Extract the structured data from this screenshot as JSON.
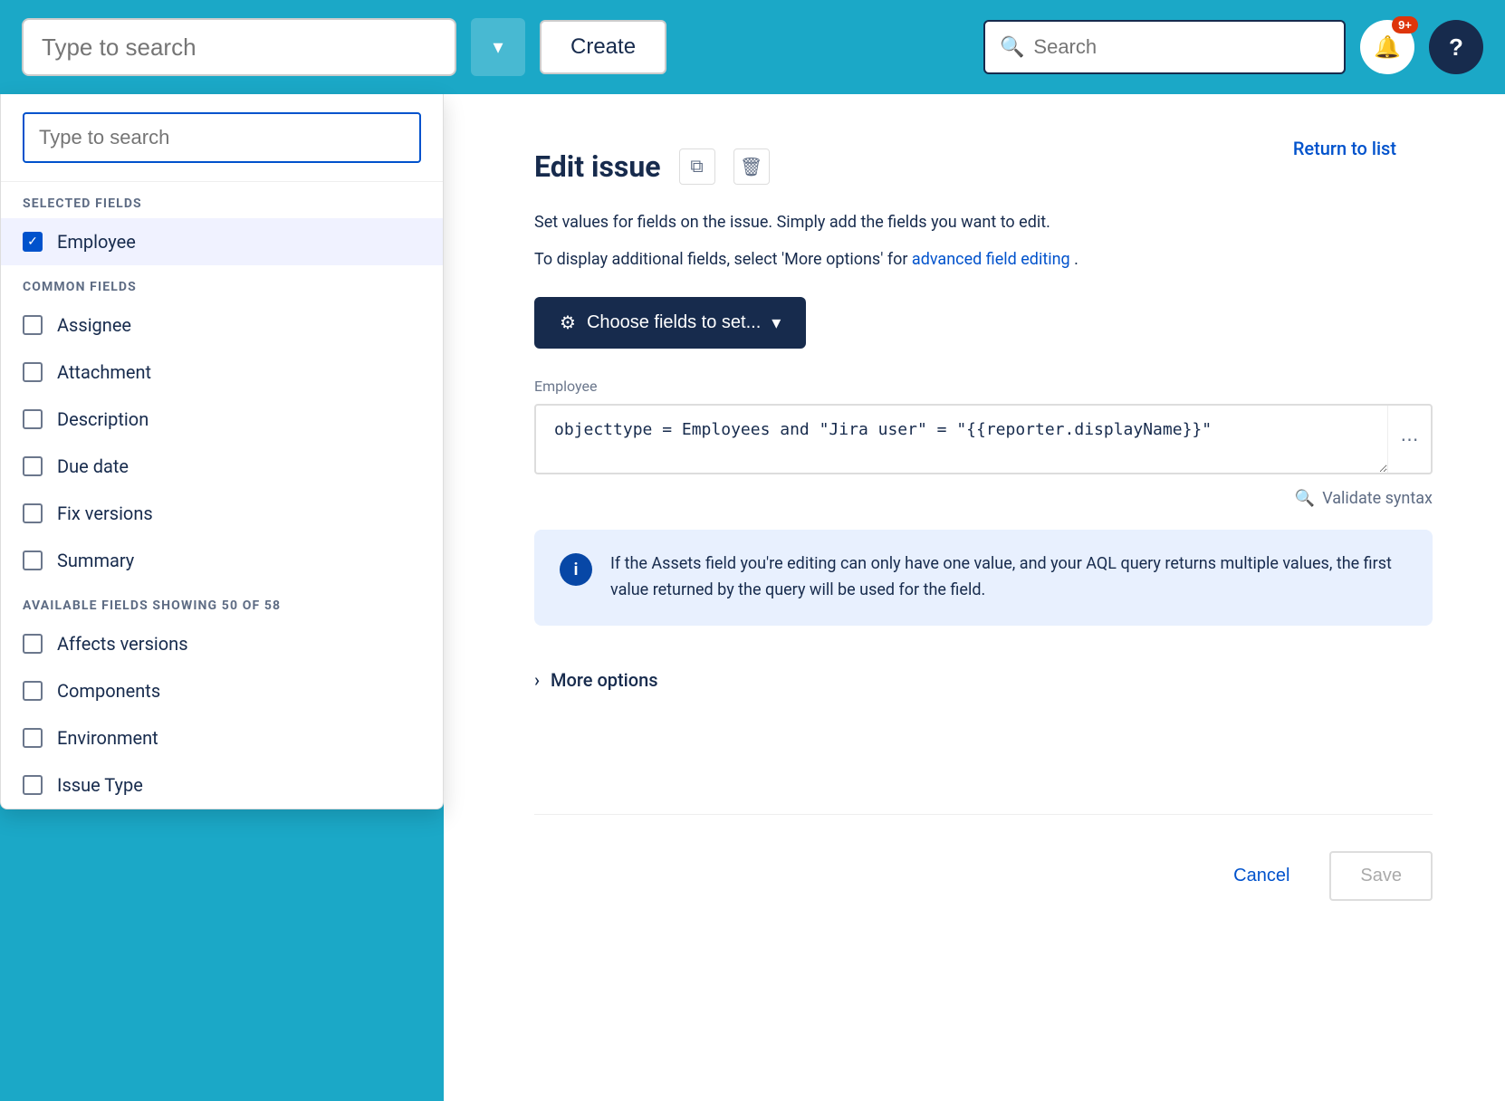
{
  "nav": {
    "search_placeholder": "Type to search",
    "create_label": "Create",
    "search_label": "Search",
    "notif_badge": "9+",
    "help_symbol": "?"
  },
  "dropdown": {
    "search_placeholder": "Type to search",
    "selected_fields_header": "SELECTED FIELDS",
    "selected_items": [
      {
        "label": "Employee",
        "checked": true
      }
    ],
    "common_fields_header": "COMMON FIELDS",
    "common_items": [
      {
        "label": "Assignee",
        "checked": false
      },
      {
        "label": "Attachment",
        "checked": false
      },
      {
        "label": "Description",
        "checked": false
      },
      {
        "label": "Due date",
        "checked": false
      },
      {
        "label": "Fix versions",
        "checked": false
      },
      {
        "label": "Summary",
        "checked": false
      }
    ],
    "available_fields_header": "AVAILABLE FIELDS SHOWING 50 OF 58",
    "available_items": [
      {
        "label": "Affects versions",
        "checked": false
      },
      {
        "label": "Components",
        "checked": false
      },
      {
        "label": "Environment",
        "checked": false
      },
      {
        "label": "Issue Type",
        "checked": false
      }
    ]
  },
  "edit": {
    "return_to_list": "Return to list",
    "title": "Edit issue",
    "description1": "Set values for fields on the issue. Simply add the fields you want to edit.",
    "description2_pre": "To display additional fields, select 'More options' for ",
    "advanced_link": "advanced field editing",
    "description2_post": ".",
    "choose_fields_label": "Choose fields to set...",
    "field_name": "Employee",
    "field_value": "objecttype = Employees and \"Jira user\" = \"{{reporter.displayName}}\"",
    "field_more_icon": "⋯",
    "validate_syntax_label": "Validate syntax",
    "info_text": "If the Assets field you're editing can only have one value, and your AQL query returns multiple values, the first value returned by the query will be used for the field.",
    "more_options_label": "More options",
    "cancel_label": "Cancel",
    "save_label": "Save"
  }
}
